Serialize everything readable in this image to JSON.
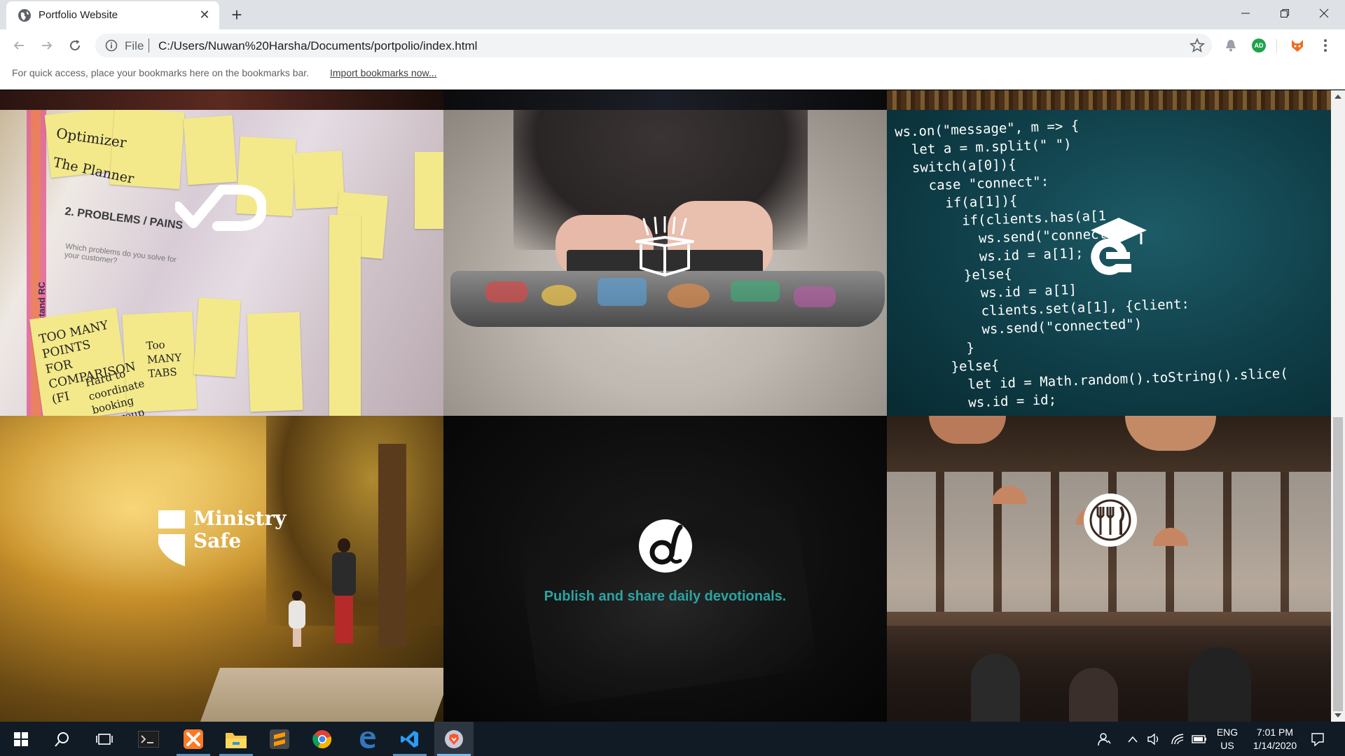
{
  "browser": {
    "tab_title": "Portfolio Website",
    "address_scheme": "File",
    "address_url": "C:/Users/Nuwan%20Harsha/Documents/portpolio/index.html",
    "bookmarks_message": "For quick access, place your bookmarks here on the bookmarks bar.",
    "bookmarks_import_link": "Import bookmarks now...",
    "extension_avatar": "AD"
  },
  "portfolio": {
    "tiles": [
      {
        "id": "vd-logo",
        "icon": "vd-logo-icon"
      },
      {
        "id": "box-logo",
        "icon": "open-box-icon"
      },
      {
        "id": "e-learning-logo",
        "icon": "e-graduation-cap-icon"
      },
      {
        "id": "ministry-safe",
        "logo_line1": "Ministry",
        "logo_line2": "Safe"
      },
      {
        "id": "daily-devotionals",
        "icon": "d-circle-logo-icon",
        "caption": "Publish and share daily devotionals."
      },
      {
        "id": "restaurant",
        "icon": "fork-knife-plate-icon"
      }
    ],
    "code_lines": [
      {
        "text": "ws.on(\"message\", m => {",
        "color": "#ffffff"
      },
      {
        "text": "  let a = m.split(\" \")",
        "color": "#ffffff"
      },
      {
        "text": "  switch(a[0]){",
        "color": "#ffffff"
      },
      {
        "text": "    case \"connect\":",
        "color": "#ffffff"
      },
      {
        "text": "      if(a[1]){",
        "color": "#ffffff"
      },
      {
        "text": "        if(clients.has(a[1",
        "color": "#ffffff"
      },
      {
        "text": "          ws.send(\"connect",
        "color": "#ffffff"
      },
      {
        "text": "          ws.id = a[1];",
        "color": "#ffffff"
      },
      {
        "text": "        }else{",
        "color": "#ffffff"
      },
      {
        "text": "          ws.id = a[1]",
        "color": "#ffffff"
      },
      {
        "text": "          clients.set(a[1], {client:",
        "color": "#ffffff"
      },
      {
        "text": "          ws.send(\"connected\")",
        "color": "#ffffff"
      },
      {
        "text": "        }",
        "color": "#ffffff"
      },
      {
        "text": "      }else{",
        "color": "#ffffff"
      },
      {
        "text": "        let id = Math.random().toString().slice(",
        "color": "#ffffff"
      },
      {
        "text": "        ws.id = id;",
        "color": "#ffffff"
      }
    ],
    "sticky_notes": {
      "header1": "Optimizer",
      "header2": "The Planner",
      "section": "2. PROBLEMS / PAINS",
      "note_a": "TOO MANY POINTS FOR COMPARISON (FI",
      "note_b": "Hard to coordinate booking for group",
      "note_c": "Too MANY TABS",
      "side_label": "Understand RC",
      "body_text": "Which problems do you solve for your customer?"
    }
  },
  "taskbar": {
    "apps": [
      "windows-start",
      "search",
      "task-view",
      "terminal",
      "xampp",
      "file-explorer",
      "sublime-text",
      "chrome",
      "edge",
      "vscode",
      "brave"
    ],
    "language_line1": "ENG",
    "language_line2": "US",
    "time": "7:01 PM",
    "date": "1/14/2020"
  },
  "colors": {
    "caption_teal": "#2ba4a1",
    "taskbar_bg": "#101b26",
    "chrome_frame": "#dee1e6"
  }
}
